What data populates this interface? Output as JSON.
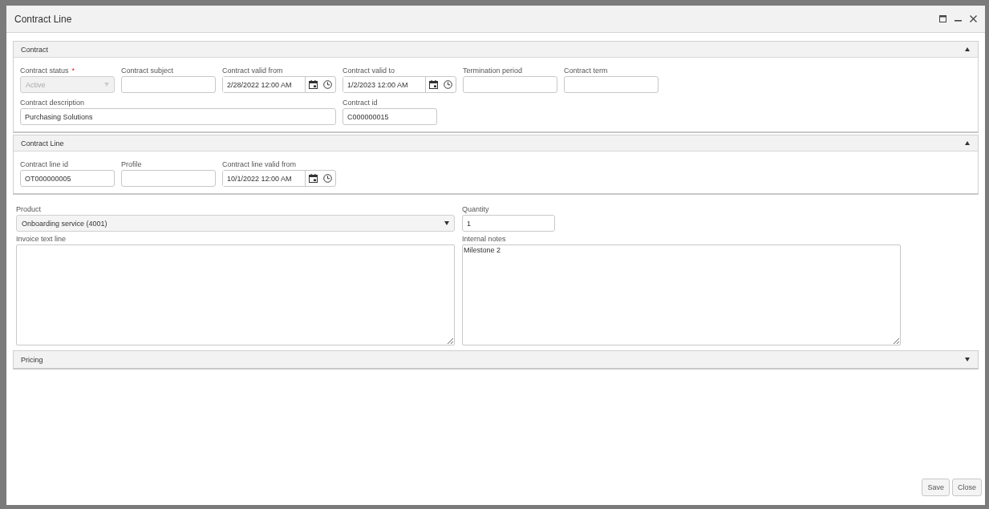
{
  "window": {
    "title": "Contract Line"
  },
  "sections": [
    {
      "title": "Contract",
      "expanded": true,
      "fields": [
        {
          "kind": "select",
          "label": "Contract status",
          "required_mark": "*",
          "value": "Active",
          "disabled": true
        },
        {
          "kind": "text",
          "label": "Contract subject"
        },
        {
          "kind": "datetime",
          "label": "Contract valid from",
          "value": "2/28/2022 12:00 AM"
        },
        {
          "kind": "datetime",
          "label": "Contract valid to",
          "value": "1/2/2023 12:00 AM"
        },
        {
          "kind": "text",
          "label": "Termination period"
        },
        {
          "kind": "text",
          "label": "Contract term"
        },
        {
          "kind": "wide",
          "label": "Contract description",
          "value": "Purchasing Solutions"
        },
        {
          "kind": "text",
          "label": "Contract id",
          "value": "C000000015"
        }
      ]
    },
    {
      "title": "Contract Line",
      "expanded": true,
      "fields": [
        {
          "kind": "text",
          "label": "Contract line id",
          "value": "OT000000005"
        },
        {
          "kind": "text",
          "label": "Profile"
        },
        {
          "kind": "datetime",
          "label": "Contract line valid from",
          "value": "10/1/2022 12:00 AM"
        }
      ]
    }
  ],
  "product": {
    "label": "Product",
    "value": "Onboarding service (4001)"
  },
  "quantity": {
    "label": "Quantity",
    "value": "1"
  },
  "invoice_text": {
    "label": "Invoice text line"
  },
  "internal_notes": {
    "label": "Internal notes",
    "value": "Milestone 2"
  },
  "pricing": {
    "title": "Pricing",
    "expanded": false
  },
  "buttons": [
    "Save",
    "Close"
  ]
}
